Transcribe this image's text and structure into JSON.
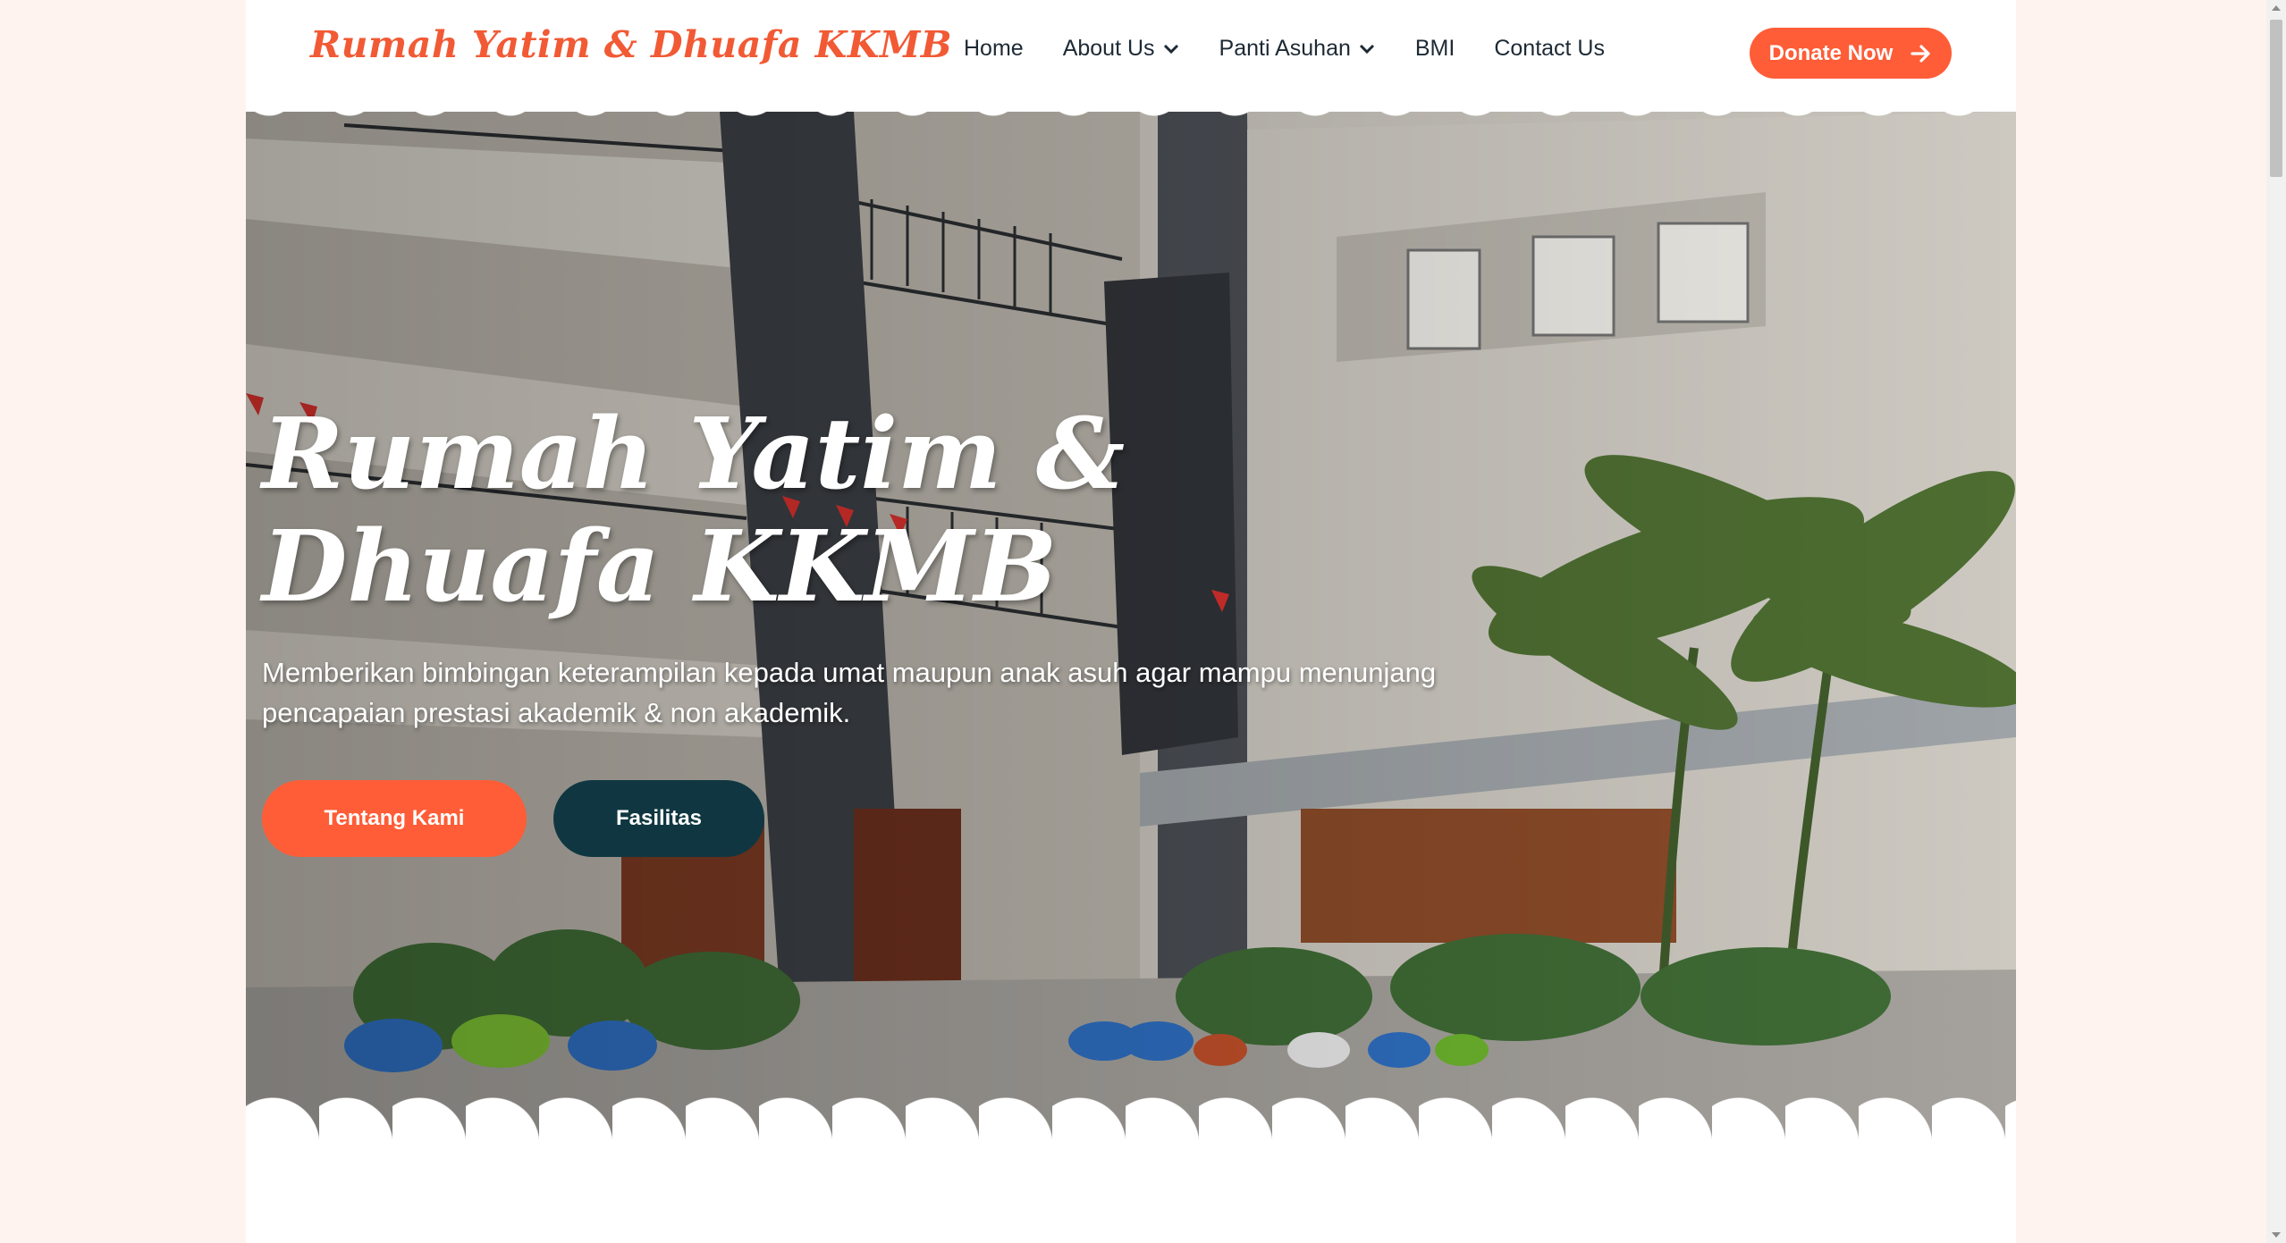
{
  "brand": {
    "name": "Rumah Yatim & Dhuafa KKMB",
    "color": "#f15a35"
  },
  "nav": {
    "items": [
      {
        "label": "Home",
        "dropdown": false
      },
      {
        "label": "About Us",
        "dropdown": true
      },
      {
        "label": "Panti Asuhan",
        "dropdown": true
      },
      {
        "label": "BMI",
        "dropdown": false
      },
      {
        "label": "Contact Us",
        "dropdown": false
      }
    ],
    "donate": {
      "label": "Donate Now",
      "icon": "arrow-right-icon",
      "color": "#fe5d37"
    }
  },
  "hero": {
    "title": "Rumah Yatim & Dhuafa KKMB",
    "subtitle": "Memberikan bimbingan keterampilan kepada umat maupun anak asuh agar mampu menunjang pencapaian prestasi akademik & non akademik.",
    "buttons": [
      {
        "label": "Tentang Kami",
        "color": "#fe5d37"
      },
      {
        "label": "Fasilitas",
        "color": "#103741"
      }
    ]
  },
  "colors": {
    "accent": "#fe5d37",
    "dark": "#103741",
    "background": "#fff3ef"
  }
}
